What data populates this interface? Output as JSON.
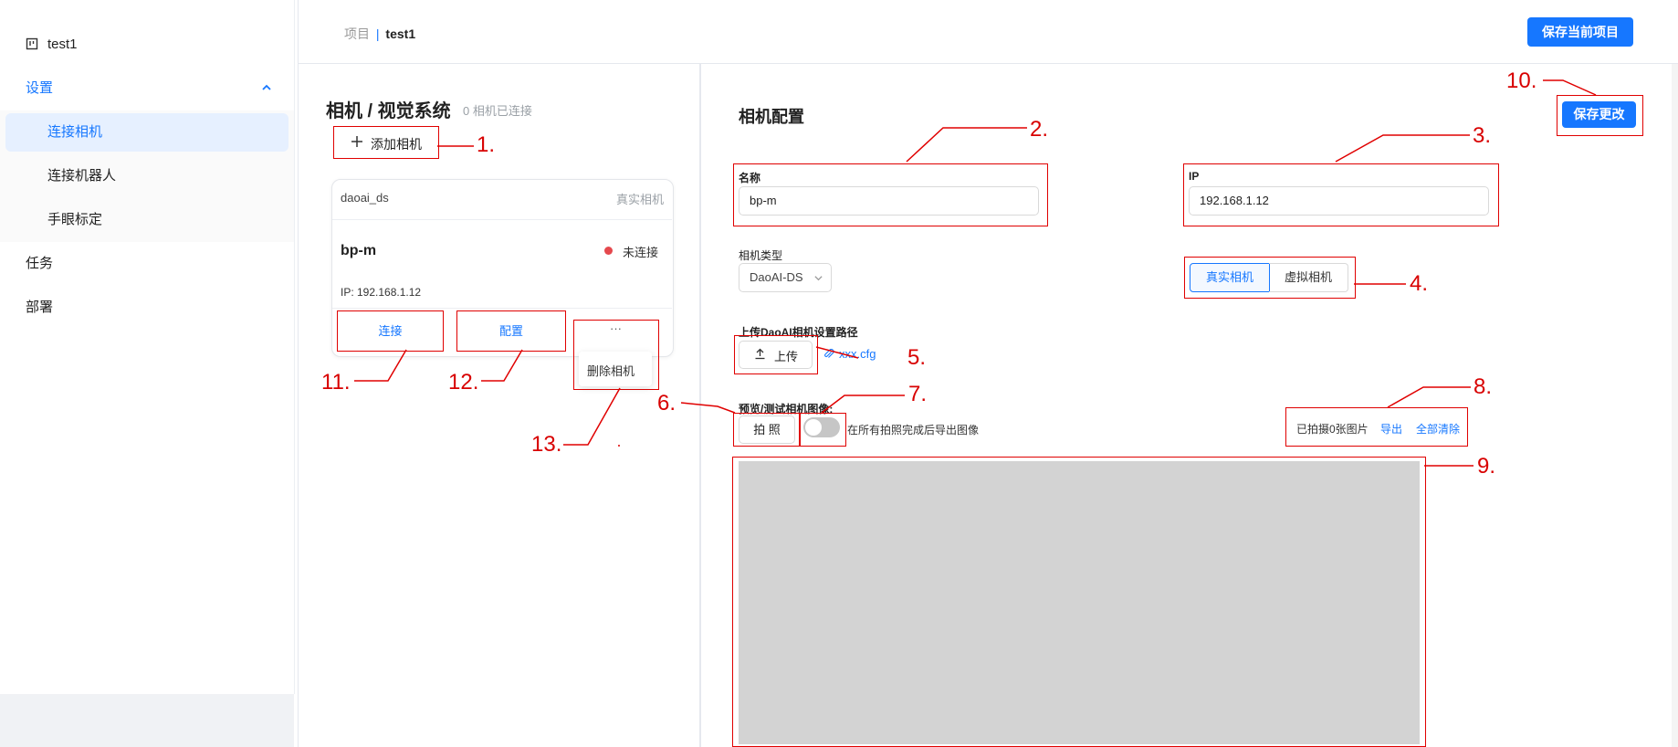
{
  "sidebar": {
    "project": "test1",
    "settings": "设置",
    "sub_items": [
      "连接相机",
      "连接机器人",
      "手眼标定"
    ],
    "task": "任务",
    "deploy": "部署"
  },
  "header": {
    "breadcrumb_root": "项目",
    "breadcrumb_sep": "|",
    "breadcrumb_current": "test1",
    "save_project": "保存当前项目"
  },
  "left_panel": {
    "title": "相机 / 视觉系统",
    "connected_count": "0 相机已连接",
    "add_camera": "添加相机",
    "card": {
      "group": "daoai_ds",
      "type_badge": "真实相机",
      "name": "bp-m",
      "status": "未连接",
      "status_color": "#e5484d",
      "ip": "IP: 192.168.1.12",
      "connect": "连接",
      "configure": "配置",
      "more": "···",
      "delete": "删除相机"
    }
  },
  "config": {
    "title": "相机配置",
    "save_changes": "保存更改",
    "name_label": "名称",
    "name_value": "bp-m",
    "ip_label": "IP",
    "ip_value": "192.168.1.12",
    "type_label": "相机类型",
    "type_value": "DaoAI-DS",
    "mode_real": "真实相机",
    "mode_virtual": "虚拟相机",
    "upload_label": "上传DaoAI相机设置路径",
    "upload_button": "上传",
    "upload_file": "xxx.cfg",
    "preview_label": "预览/测试相机图像:",
    "capture_button": "拍 照",
    "toggle_label": "在所有拍照完成后导出图像",
    "shot_count": "已拍摄0张图片",
    "export": "导出",
    "clear_all": "全部清除"
  },
  "annotations": [
    "1.",
    "2.",
    "3.",
    "4.",
    "5.",
    "6.",
    "7.",
    "8.",
    "9.",
    "10.",
    "11.",
    "12.",
    "13."
  ],
  "colors": {
    "accent": "#1677ff",
    "annotation": "#e00000",
    "preview_bg": "#d3d3d3"
  }
}
